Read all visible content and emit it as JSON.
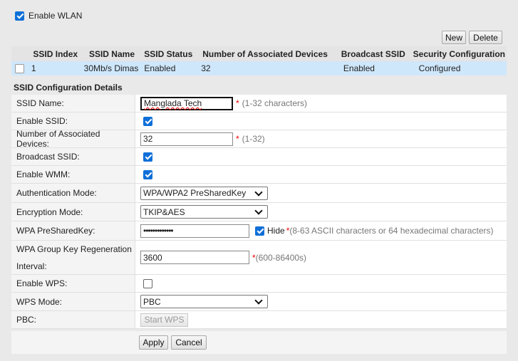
{
  "wlan": {
    "enable_label": "Enable WLAN",
    "enabled": true
  },
  "toolbar": {
    "new_label": "New",
    "delete_label": "Delete"
  },
  "table": {
    "headers": [
      "",
      "SSID Index",
      "SSID Name",
      "SSID Status",
      "Number of Associated Devices",
      "Broadcast SSID",
      "Security Configuration"
    ],
    "rows": [
      {
        "index": "1",
        "name": "30Mb/s Dimas",
        "status": "Enabled",
        "devices": "32",
        "broadcast": "Enabled",
        "security": "Configured"
      }
    ]
  },
  "details": {
    "title": "SSID Configuration Details",
    "ssid_name": {
      "label": "SSID Name:",
      "value": "Manglada Tech",
      "hint": "(1-32 characters)"
    },
    "enable_ssid": {
      "label": "Enable SSID:",
      "checked": true
    },
    "assoc_devices": {
      "label": "Number of Associated Devices:",
      "value": "32",
      "hint": "(1-32)"
    },
    "broadcast_ssid": {
      "label": "Broadcast SSID:",
      "checked": true
    },
    "enable_wmm": {
      "label": "Enable WMM:",
      "checked": true
    },
    "auth_mode": {
      "label": "Authentication Mode:",
      "value": "WPA/WPA2 PreSharedKey"
    },
    "encryption_mode": {
      "label": "Encryption Mode:",
      "value": "TKIP&AES"
    },
    "psk": {
      "label": "WPA PreSharedKey:",
      "value": "•••••••••••••",
      "hide_label": "Hide",
      "hide_checked": true,
      "hint": "(8-63 ASCII characters or 64 hexadecimal characters)"
    },
    "group_key": {
      "label_line1": "WPA Group Key Regeneration",
      "label_line2": "Interval:",
      "value": "3600",
      "hint": "(600-86400s)"
    },
    "enable_wps": {
      "label": "Enable WPS:",
      "checked": false
    },
    "wps_mode": {
      "label": "WPS Mode:",
      "value": "PBC"
    },
    "pbc": {
      "label": "PBC:",
      "button": "Start WPS"
    }
  },
  "actions": {
    "apply_label": "Apply",
    "cancel_label": "Cancel"
  },
  "colors": {
    "accent": "#0f6fd8",
    "selected_row": "#cfe7fb",
    "required_star": "#e00000"
  },
  "required_marker": "*"
}
